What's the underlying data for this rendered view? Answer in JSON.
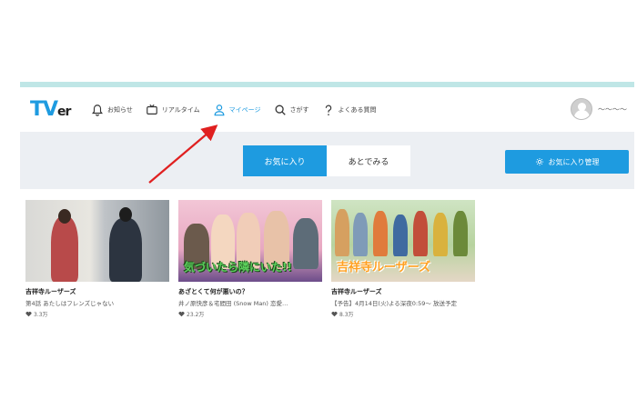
{
  "header": {
    "logo_main": "TV",
    "logo_sub": "er",
    "nav": [
      {
        "label": "お知らせ",
        "icon": "bell-icon"
      },
      {
        "label": "リアルタイム",
        "icon": "tv-icon"
      },
      {
        "label": "マイページ",
        "icon": "user-icon",
        "active": true
      },
      {
        "label": "さがす",
        "icon": "search-icon"
      },
      {
        "label": "よくある質問",
        "icon": "question-icon"
      }
    ],
    "user_name": "〜〜〜〜"
  },
  "tabs": [
    {
      "label": "お気に入り",
      "active": true
    },
    {
      "label": "あとでみる",
      "active": false
    }
  ],
  "manage_button": "お気に入り管理",
  "cards": [
    {
      "title": "吉祥寺ルーザーズ",
      "subtitle": "第4話 あたしはフレンズじゃない",
      "meta": "3.3万"
    },
    {
      "title": "あざとくて何が悪いの？",
      "subtitle": "井ノ原快彦＆宅間田 (Snow Man) 恋愛…",
      "meta": "23.2万",
      "thumb_caption": "気づいたら隣にいた!!"
    },
    {
      "title": "吉祥寺ルーザーズ",
      "subtitle": "【予告】4月14日(火)よる深夜0:59〜 放送予定",
      "meta": "8.3万",
      "thumb_caption": "吉祥寺ルーザーズ"
    }
  ],
  "colors": {
    "accent": "#1e9be0",
    "annotation": "#e02020"
  }
}
